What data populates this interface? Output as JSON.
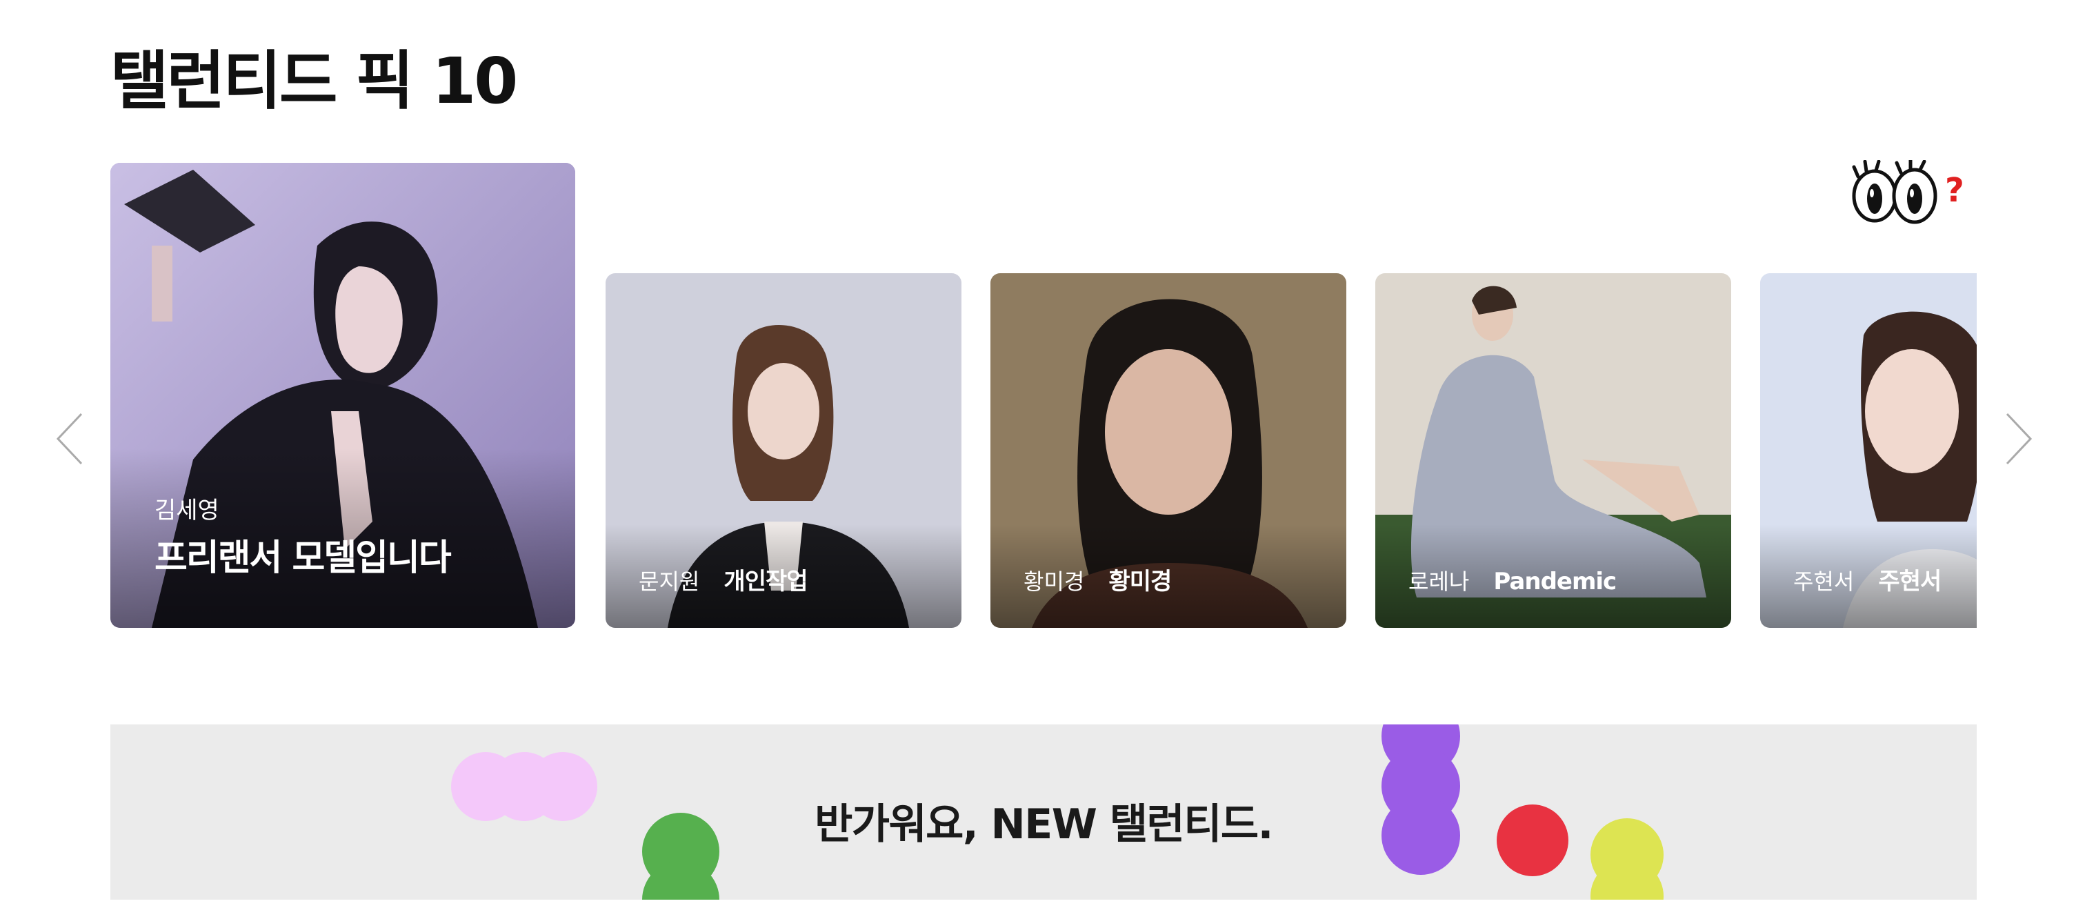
{
  "section": {
    "title": "탤런티드 픽 10"
  },
  "nav": {
    "prev_icon": "chevron-left-icon",
    "next_icon": "chevron-right-icon"
  },
  "mascot": {
    "icon": "googly-eyes-question-icon",
    "mark": "?"
  },
  "cards": [
    {
      "name": "김세영",
      "tagline": "프리랜서 모델입니다",
      "bg": "#b2a4d4"
    },
    {
      "name": "문지원",
      "tagline": "개인작업",
      "bg": "#cfd0dc"
    },
    {
      "name": "황미경",
      "tagline": "황미경",
      "bg": "#8d7a5e"
    },
    {
      "name": "로레나",
      "tagline": "Pandemic",
      "bg": "#dcd6cc"
    },
    {
      "name": "주현서",
      "tagline": "주현서",
      "bg": "#d9dff0"
    }
  ],
  "banner": {
    "text": "반가워요, NEW 탤런티드.",
    "colors": {
      "bg": "#ebebeb",
      "pink": "#f4c8fa",
      "green": "#56b04e",
      "purple": "#9a5ce6",
      "red": "#e83241",
      "yellow": "#dde452"
    }
  }
}
